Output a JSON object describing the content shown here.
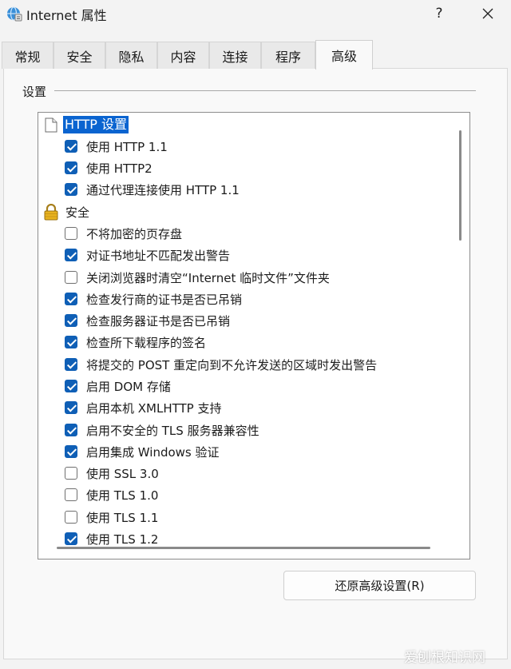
{
  "window": {
    "title": "Internet 属性",
    "help_label": "?",
    "close_icon": "close-icon",
    "app_icon": "internet-options-icon"
  },
  "tabs": [
    {
      "label": "常规"
    },
    {
      "label": "安全"
    },
    {
      "label": "隐私"
    },
    {
      "label": "内容"
    },
    {
      "label": "连接"
    },
    {
      "label": "程序"
    },
    {
      "label": "高级",
      "active": true
    }
  ],
  "settings": {
    "group_label": "设置",
    "items": [
      {
        "type": "category",
        "icon": "page-icon",
        "label": "HTTP 设置",
        "selected": true
      },
      {
        "type": "checkbox",
        "checked": true,
        "label": "使用 HTTP 1.1"
      },
      {
        "type": "checkbox",
        "checked": true,
        "label": "使用 HTTP2"
      },
      {
        "type": "checkbox",
        "checked": true,
        "label": "通过代理连接使用 HTTP 1.1"
      },
      {
        "type": "category",
        "icon": "lock-icon",
        "label": "安全"
      },
      {
        "type": "checkbox",
        "checked": false,
        "label": "不将加密的页存盘"
      },
      {
        "type": "checkbox",
        "checked": true,
        "label": "对证书地址不匹配发出警告"
      },
      {
        "type": "checkbox",
        "checked": false,
        "label": "关闭浏览器时清空“Internet 临时文件”文件夹"
      },
      {
        "type": "checkbox",
        "checked": true,
        "label": "检查发行商的证书是否已吊销"
      },
      {
        "type": "checkbox",
        "checked": true,
        "label": "检查服务器证书是否已吊销"
      },
      {
        "type": "checkbox",
        "checked": true,
        "label": "检查所下载程序的签名"
      },
      {
        "type": "checkbox",
        "checked": true,
        "label": "将提交的 POST 重定向到不允许发送的区域时发出警告"
      },
      {
        "type": "checkbox",
        "checked": true,
        "label": "启用 DOM 存储"
      },
      {
        "type": "checkbox",
        "checked": true,
        "label": "启用本机 XMLHTTP 支持"
      },
      {
        "type": "checkbox",
        "checked": true,
        "label": "启用不安全的 TLS 服务器兼容性"
      },
      {
        "type": "checkbox",
        "checked": true,
        "label": "启用集成 Windows 验证"
      },
      {
        "type": "checkbox",
        "checked": false,
        "label": "使用 SSL 3.0"
      },
      {
        "type": "checkbox",
        "checked": false,
        "label": "使用 TLS 1.0"
      },
      {
        "type": "checkbox",
        "checked": false,
        "label": "使用 TLS 1.1"
      },
      {
        "type": "checkbox",
        "checked": true,
        "label": "使用 TLS 1.2"
      }
    ]
  },
  "restore_button": {
    "label": "还原高级设置(R)"
  },
  "watermark": "爱刨根知识网",
  "colors": {
    "accent": "#0f5fb6",
    "selection": "#0a64d0"
  }
}
